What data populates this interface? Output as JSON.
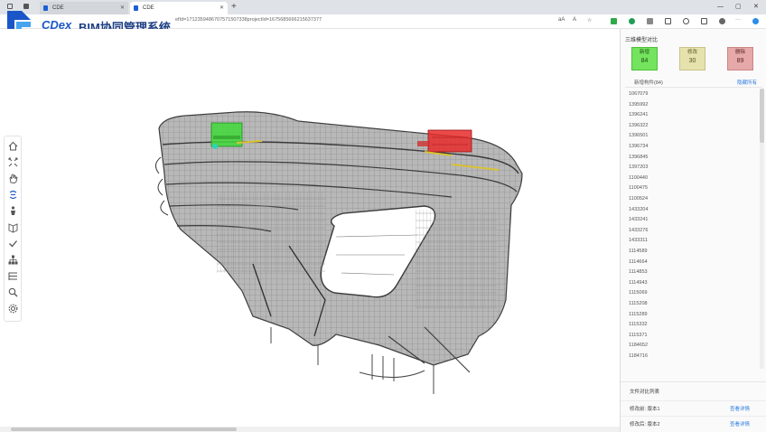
{
  "browser": {
    "tabs": [
      {
        "label": "CDE"
      },
      {
        "label": "CDE"
      }
    ],
    "new_tab": "+",
    "url": "efId=1712359486707571507338projectId=1675685666215637377",
    "toolbar_text": "aA"
  },
  "app": {
    "logo_text": "CDex",
    "title": "BIM协同管理系统",
    "accent": "#1a56c8"
  },
  "toolbar": {
    "tools": [
      {
        "icon": "home-icon"
      },
      {
        "icon": "fit-view-icon"
      },
      {
        "icon": "pan-hand-icon"
      },
      {
        "icon": "rotate-icon"
      },
      {
        "icon": "person-icon"
      },
      {
        "icon": "section-icon"
      },
      {
        "icon": "check-icon"
      },
      {
        "icon": "structure-tree-icon"
      },
      {
        "icon": "properties-list-icon"
      },
      {
        "icon": "search-icon"
      },
      {
        "icon": "settings-gear-icon"
      }
    ]
  },
  "panel": {
    "title": "三维模型对比",
    "stats": {
      "added": {
        "label": "新增",
        "value": "84",
        "color": "#74e35e"
      },
      "modified": {
        "label": "修改",
        "value": "30",
        "color": "#e6e2ad"
      },
      "deleted": {
        "label": "删除",
        "value": "89",
        "color": "#e6a8a8"
      }
    },
    "list_title": "新增构件(84)",
    "list_toggle": "隐藏所有",
    "ids": [
      "1067079",
      "1395992",
      "1396241",
      "1396322",
      "1396501",
      "1396734",
      "1396845",
      "1397203",
      "1100440",
      "1100475",
      "1100524",
      "1433204",
      "1433241",
      "1433276",
      "1433311",
      "1114589",
      "1114664",
      "1114853",
      "1114943",
      "1115069",
      "1115208",
      "1115289",
      "1115332",
      "1115371",
      "1184652",
      "1184716"
    ],
    "compare_title": "文件对比列表",
    "compare_rows": [
      {
        "label": "修改前: 版本1",
        "link": "查看详情"
      },
      {
        "label": "修改后: 版本2",
        "link": "查看详情"
      }
    ]
  }
}
